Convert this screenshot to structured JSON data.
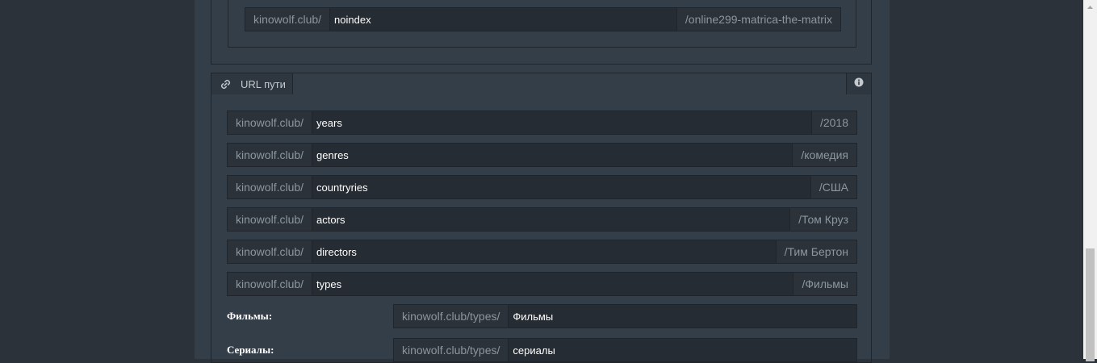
{
  "top_section": {
    "row": {
      "prefix": "kinowolf.club/",
      "value": "noindex",
      "suffix": "/online299-matrica-the-matrix"
    }
  },
  "url_section": {
    "tab_label": "URL пути",
    "tab_icon": "link-icon",
    "info_icon": "info-icon",
    "rows": [
      {
        "prefix": "kinowolf.club/",
        "value": "years",
        "suffix": "/2018"
      },
      {
        "prefix": "kinowolf.club/",
        "value": "genres",
        "suffix": "/комедия"
      },
      {
        "prefix": "kinowolf.club/",
        "value": "countryries",
        "suffix": "/США"
      },
      {
        "prefix": "kinowolf.club/",
        "value": "actors",
        "suffix": "/Том Круз"
      },
      {
        "prefix": "kinowolf.club/",
        "value": "directors",
        "suffix": "/Тим Бертон"
      },
      {
        "prefix": "kinowolf.club/",
        "value": "types",
        "suffix": "/Фильмы"
      }
    ],
    "type_rows": [
      {
        "label": "Фильмы:",
        "prefix": "kinowolf.club/types/",
        "value": "Фильмы"
      },
      {
        "label": "Сериалы:",
        "prefix": "kinowolf.club/types/",
        "value": "сериалы"
      }
    ]
  },
  "colors": {
    "page_bg": "#2b3239",
    "panel_bg": "#343e48",
    "input_bg": "#262c33",
    "border": "#1f252b"
  }
}
